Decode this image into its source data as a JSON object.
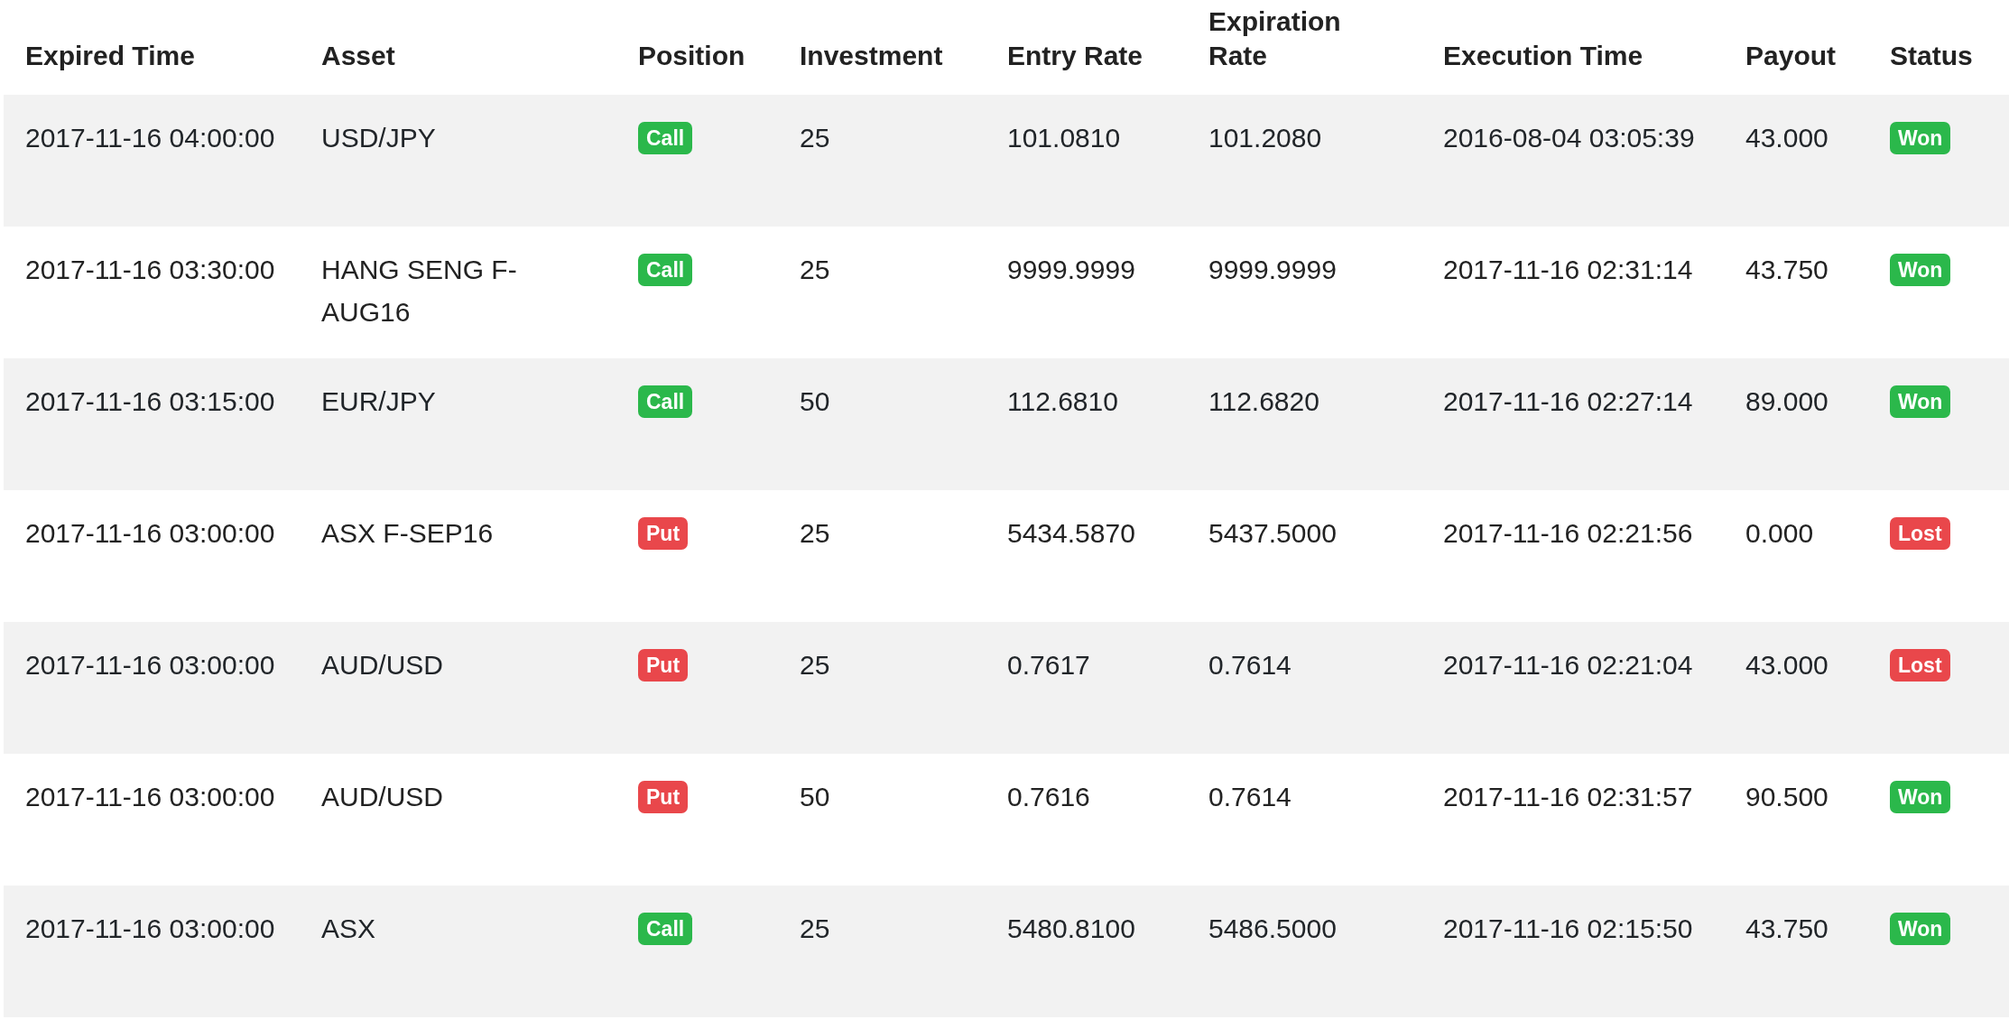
{
  "table": {
    "columns": [
      "Expired Time",
      "Asset",
      "Position",
      "Investment",
      "Entry Rate",
      "Expiration Rate",
      "Execution Time",
      "Payout",
      "Status"
    ],
    "rows": [
      {
        "expired_time": "2017-11-16 04:00:00",
        "asset": "USD/JPY",
        "position": {
          "label": "Call",
          "color": "#2bb84b"
        },
        "investment": "25",
        "entry_rate": "101.0810",
        "expiration_rate": "101.2080",
        "execution_time": "2016-08-04 03:05:39",
        "payout": "43.000",
        "status": {
          "label": "Won",
          "color": "#2bb84b"
        }
      },
      {
        "expired_time": "2017-11-16 03:30:00",
        "asset": "HANG SENG F-AUG16",
        "position": {
          "label": "Call",
          "color": "#2bb84b"
        },
        "investment": "25",
        "entry_rate": "9999.9999",
        "expiration_rate": "9999.9999",
        "execution_time": "2017-11-16 02:31:14",
        "payout": "43.750",
        "status": {
          "label": "Won",
          "color": "#2bb84b"
        }
      },
      {
        "expired_time": "2017-11-16 03:15:00",
        "asset": "EUR/JPY",
        "position": {
          "label": "Call",
          "color": "#2bb84b"
        },
        "investment": "50",
        "entry_rate": "112.6810",
        "expiration_rate": "112.6820",
        "execution_time": "2017-11-16 02:27:14",
        "payout": "89.000",
        "status": {
          "label": "Won",
          "color": "#2bb84b"
        }
      },
      {
        "expired_time": "2017-11-16 03:00:00",
        "asset": "ASX F-SEP16",
        "position": {
          "label": "Put",
          "color": "#e9474b"
        },
        "investment": "25",
        "entry_rate": "5434.5870",
        "expiration_rate": "5437.5000",
        "execution_time": "2017-11-16 02:21:56",
        "payout": "0.000",
        "status": {
          "label": "Lost",
          "color": "#e9474b"
        }
      },
      {
        "expired_time": "2017-11-16 03:00:00",
        "asset": "AUD/USD",
        "position": {
          "label": "Put",
          "color": "#e9474b"
        },
        "investment": "25",
        "entry_rate": "0.7617",
        "expiration_rate": "0.7614",
        "execution_time": "2017-11-16 02:21:04",
        "payout": "43.000",
        "status": {
          "label": "Lost",
          "color": "#e9474b"
        }
      },
      {
        "expired_time": "2017-11-16 03:00:00",
        "asset": "AUD/USD",
        "position": {
          "label": "Put",
          "color": "#e9474b"
        },
        "investment": "50",
        "entry_rate": "0.7616",
        "expiration_rate": "0.7614",
        "execution_time": "2017-11-16 02:31:57",
        "payout": "90.500",
        "status": {
          "label": "Won",
          "color": "#2bb84b"
        }
      },
      {
        "expired_time": "2017-11-16 03:00:00",
        "asset": "ASX",
        "position": {
          "label": "Call",
          "color": "#2bb84b"
        },
        "investment": "25",
        "entry_rate": "5480.8100",
        "expiration_rate": "5486.5000",
        "execution_time": "2017-11-16 02:15:50",
        "payout": "43.750",
        "status": {
          "label": "Won",
          "color": "#2bb84b"
        }
      }
    ]
  }
}
